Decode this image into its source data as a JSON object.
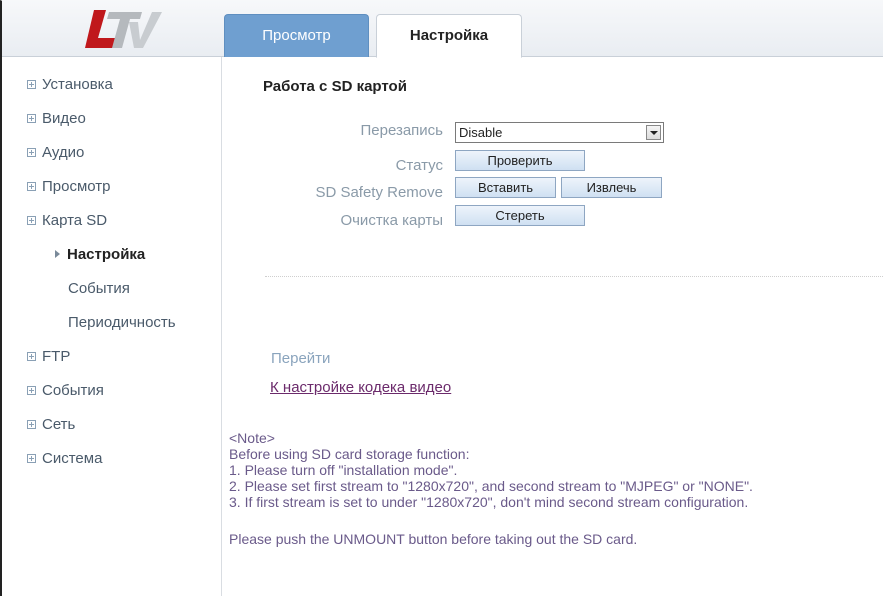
{
  "logo": {
    "text": "LTV"
  },
  "tabs": [
    {
      "label": "Просмотр",
      "active": false
    },
    {
      "label": "Настройка",
      "active": true
    }
  ],
  "sidebar": {
    "items": [
      {
        "label": "Установка"
      },
      {
        "label": "Видео"
      },
      {
        "label": "Аудио"
      },
      {
        "label": "Просмотр"
      },
      {
        "label": "Карта SD"
      }
    ],
    "sd_sub": [
      {
        "label": "Настройка",
        "active": true
      },
      {
        "label": "События"
      },
      {
        "label": "Периодичность"
      }
    ],
    "items_after": [
      {
        "label": "FTP"
      },
      {
        "label": "События"
      },
      {
        "label": "Сеть"
      },
      {
        "label": "Система"
      }
    ]
  },
  "main": {
    "title": "Работа с SD картой",
    "overwrite": {
      "label": "Перезапись",
      "value": "Disable"
    },
    "status": {
      "label": "Статус",
      "button": "Проверить"
    },
    "safety": {
      "label": "SD Safety Remove",
      "insert": "Вставить",
      "remove": "Извлечь"
    },
    "clear": {
      "label": "Очистка карты",
      "button": "Стереть"
    },
    "goto_label": "Перейти",
    "goto_link": "К настройке кодека видео",
    "notes": [
      "<Note>",
      "Before using SD card storage function:",
      " 1. Please turn off \"installation mode\".",
      " 2. Please set first stream to \"1280x720\", and second stream to \"MJPEG\" or \"NONE\".",
      " 3. If first stream is set to under \"1280x720\", don't mind second stream configuration."
    ],
    "unmount_note": "Please push the UNMOUNT button before taking out the SD card."
  },
  "colors": {
    "tab_inactive": "#6f9fd0",
    "logo_red": "#c0181c",
    "logo_gray": "#b5b9bd",
    "link": "#6b2a6b"
  }
}
